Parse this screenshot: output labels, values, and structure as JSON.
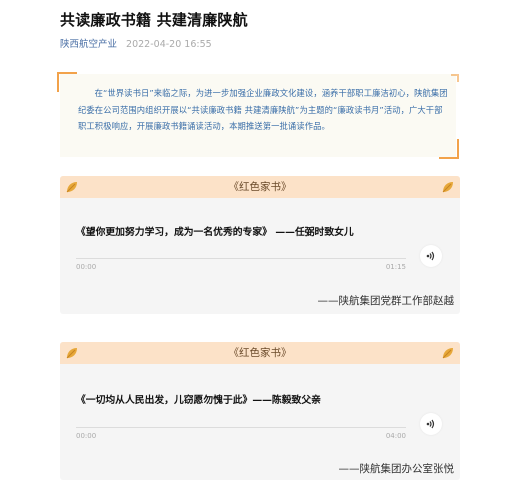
{
  "article": {
    "title": "共读廉政书籍 共建清廉陕航",
    "source": "陕西航空产业",
    "datetime": "2022-04-20 16:55",
    "intro": "在“世界读书日”来临之际，为进一步加强企业廉政文化建设，涵养干部职工廉洁初心，陕航集团纪委在公司范围内组织开展以“共读廉政书籍 共建清廉陕航”为主题的“廉政读书月”活动，广大干部职工积极响应，开展廉政书籍诵读活动，本期推送第一批诵读作品。"
  },
  "cards": [
    {
      "header": "《红色家书》",
      "quote": "《望你更加努力学习，成为一名优秀的专家》 ——任弼时致女儿",
      "time_start": "00:00",
      "time_end": "01:15",
      "signature": "——陕航集团党群工作部赵越"
    },
    {
      "header": "《红色家书》",
      "quote": "《一切均从人民出发，儿窃愿勿愧于此》——陈毅致父亲",
      "time_start": "00:00",
      "time_end": "04:00",
      "signature": "——陕航集团办公室张悦"
    }
  ],
  "colors": {
    "header_bg": "#fce2c8",
    "intro_text": "#3a6ea8",
    "corner_accent": "#f2a24a",
    "source_link": "#4a6fa5"
  },
  "icons": {
    "leaf": "leaf-icon",
    "audio": "speaker-icon"
  }
}
